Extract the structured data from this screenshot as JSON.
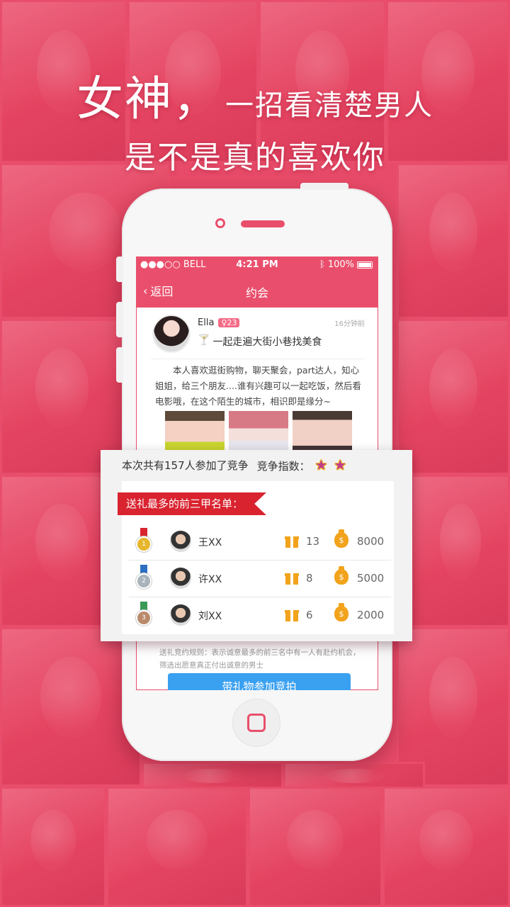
{
  "headline": {
    "line1_main": "女神，",
    "line1_rest": "一招看清楚男人",
    "line2": "是不是真的喜欢你"
  },
  "status_bar": {
    "carrier": "●●●○○ BELL",
    "time": "4:21 PM",
    "battery": "100%"
  },
  "nav": {
    "back_label": "返回",
    "title": "约会"
  },
  "post": {
    "name": "Ella",
    "age": "23",
    "time": "16分钟前",
    "topic": "一起走遍大街小巷找美食",
    "body": "本人喜欢逛街购物，聊天聚会，part达人，知心姐姐，给三个朋友....谁有兴趣可以一起吃饭，然后看电影哦，在这个陌生的城市，相识即是缘分~"
  },
  "competition": {
    "summary": "本次共有157人参加了竞争",
    "index_label": "竞争指数：",
    "index_stars": 2,
    "ribbon": "送礼最多的前三甲名单：",
    "ranks": [
      {
        "place": "1",
        "name": "王XX",
        "gifts": "13",
        "coins": "8000"
      },
      {
        "place": "2",
        "name": "许XX",
        "gifts": "8",
        "coins": "5000"
      },
      {
        "place": "3",
        "name": "刘XX",
        "gifts": "6",
        "coins": "2000"
      }
    ]
  },
  "rules": "送礼竞约规则：表示诚意最多的前三名中有一人有赴约机会，筛选出愿意真正付出诚意的男士",
  "join_button": "带礼物参加竞拍",
  "colors": {
    "brand": "#e94f6c",
    "button": "#3aa0f0",
    "gift": "#f2a31b",
    "ribbon": "#d9232f"
  }
}
